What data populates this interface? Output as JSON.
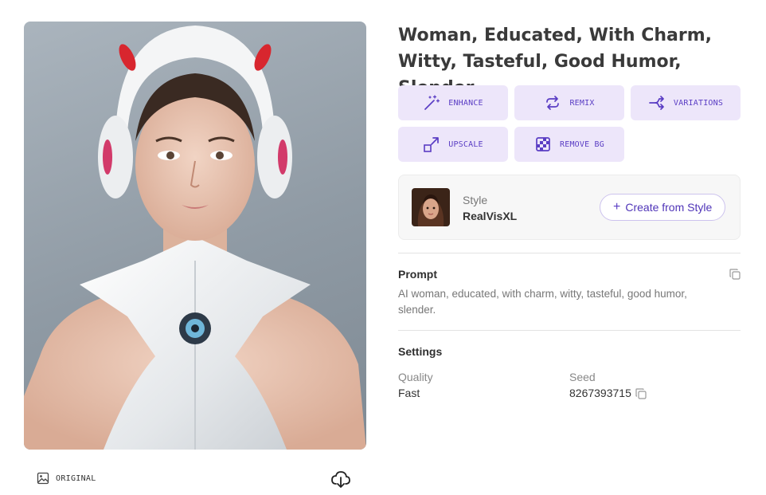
{
  "image": {
    "alt": "Woman in white robotic suit with headphone helmet",
    "original_label": "ORIGINAL"
  },
  "title": "Woman, Educated, With Charm, Witty, Tasteful, Good Humor, Slender.",
  "actions": [
    {
      "label": "ENHANCE",
      "icon": "magic-wand-icon"
    },
    {
      "label": "REMIX",
      "icon": "repeat-icon"
    },
    {
      "label": "VARIATIONS",
      "icon": "split-arrows-icon"
    },
    {
      "label": "UPSCALE",
      "icon": "expand-arrow-icon"
    },
    {
      "label": "REMOVE BG",
      "icon": "transparency-grid-icon"
    }
  ],
  "style": {
    "kicker": "Style",
    "name": "RealVisXL",
    "create_label": "Create from Style"
  },
  "prompt": {
    "heading": "Prompt",
    "text": "AI woman, educated, with charm, witty, tasteful, good humor, slender."
  },
  "settings": {
    "heading": "Settings",
    "quality_label": "Quality",
    "quality_value": "Fast",
    "seed_label": "Seed",
    "seed_value": "8267393715"
  },
  "colors": {
    "accent": "#5a3dc4",
    "button_bg": "#ede6fa",
    "card_bg": "#f7f7f7"
  }
}
